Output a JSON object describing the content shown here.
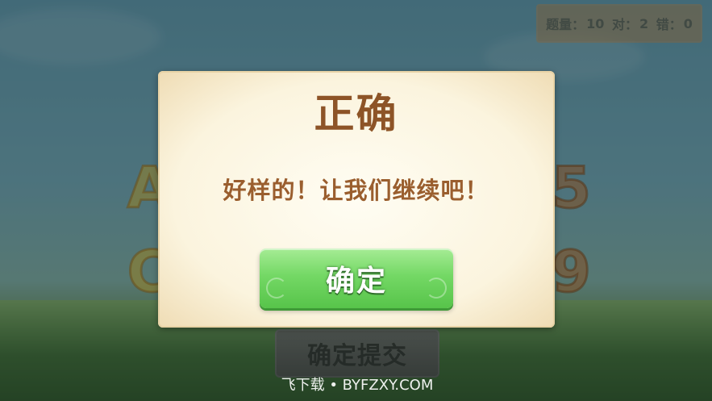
{
  "score": {
    "question_count_label": "题量：",
    "question_count_value": "10",
    "correct_label": "对：",
    "correct_value": "2",
    "wrong_label": "错：",
    "wrong_value": "0"
  },
  "background": {
    "letters": [
      "A",
      "C"
    ],
    "digits": [
      "5",
      "9"
    ]
  },
  "dialog": {
    "title": "正确",
    "message": "好样的！让我们继续吧！",
    "confirm_label": "确定"
  },
  "submit_button_label": "确定提交",
  "watermark": "飞下载 • BYFZXY.COM",
  "colors": {
    "dialog_title": "#8d5427",
    "confirm_button": "#74d865",
    "score_panel": "#b98a52"
  }
}
